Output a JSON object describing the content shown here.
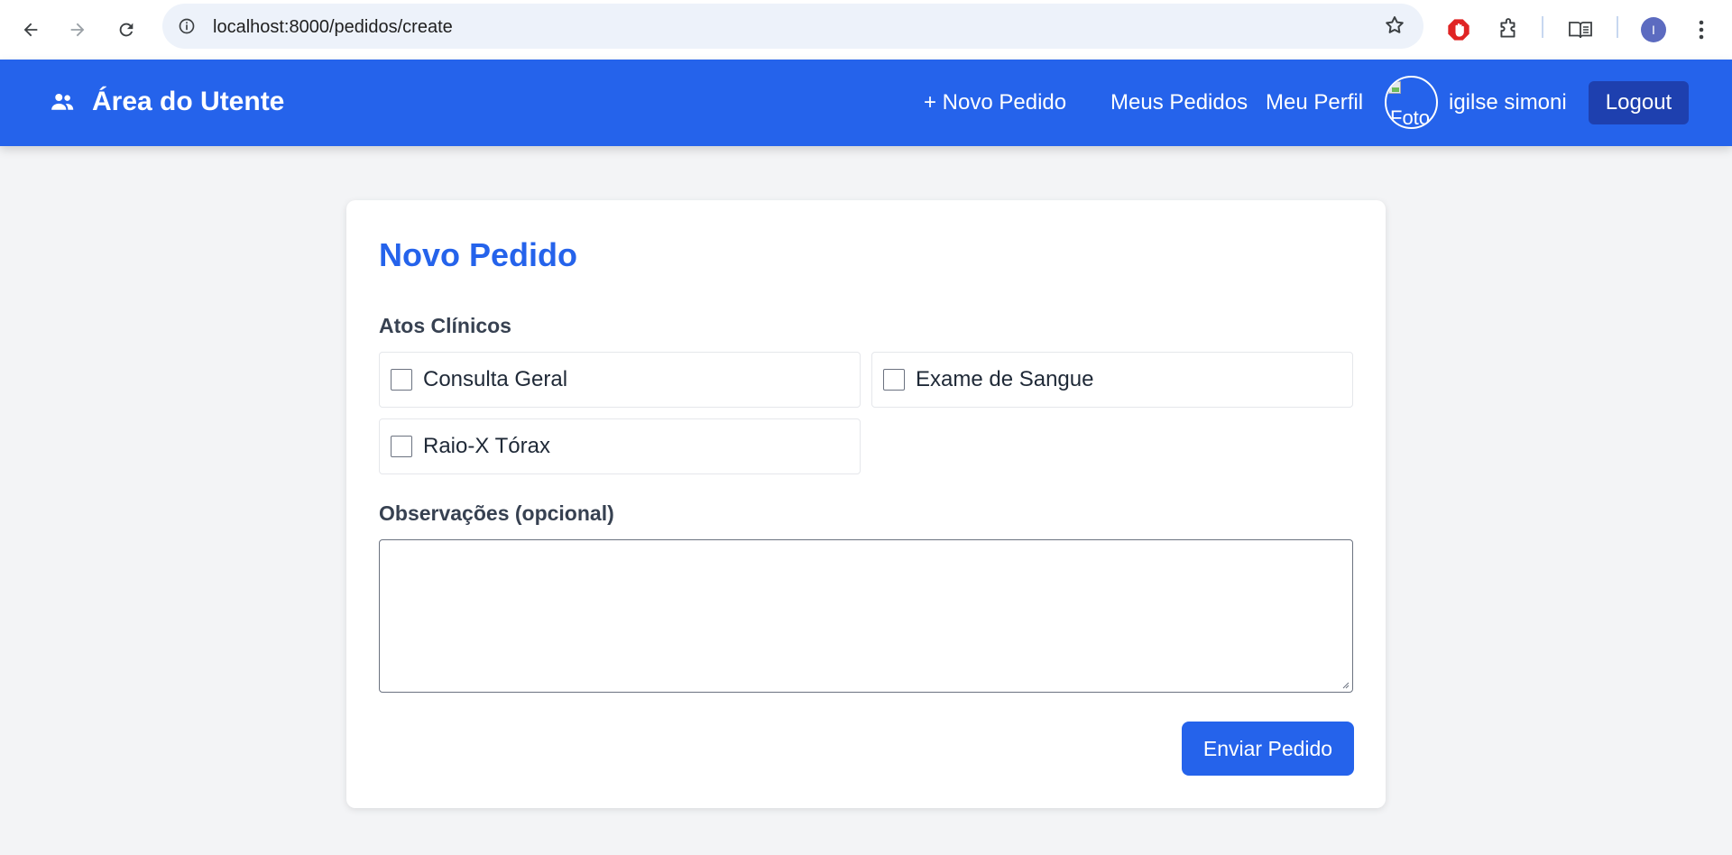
{
  "browser": {
    "url": "localhost:8000/pedidos/create",
    "profile_initial": "I"
  },
  "header": {
    "brand_title": "Área do Utente",
    "nav": {
      "novo_pedido": "+ Novo Pedido",
      "meus_pedidos": "Meus Pedidos",
      "meu_perfil": "Meu Perfil"
    },
    "avatar_alt": "Foto",
    "username": "igilse simoni",
    "logout_label": "Logout",
    "colors": {
      "primary": "#2563eb",
      "logout_bg": "#1e40af"
    }
  },
  "form": {
    "title": "Novo Pedido",
    "atos_label": "Atos Clínicos",
    "atos": [
      {
        "label": "Consulta Geral",
        "checked": false
      },
      {
        "label": "Exame de Sangue",
        "checked": false
      },
      {
        "label": "Raio-X Tórax",
        "checked": false
      }
    ],
    "obs_label": "Observações (opcional)",
    "obs_value": "",
    "submit_label": "Enviar Pedido"
  }
}
